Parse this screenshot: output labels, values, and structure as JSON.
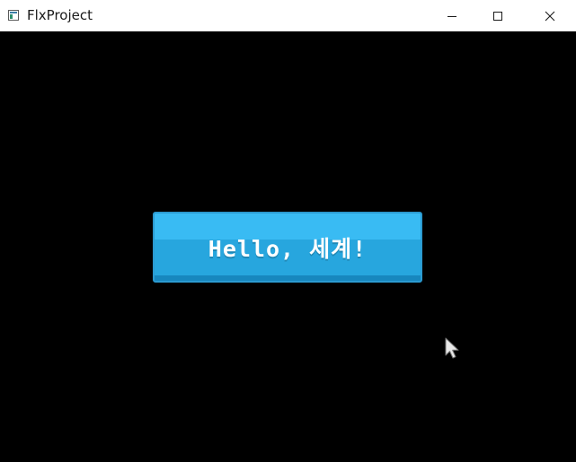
{
  "window": {
    "title": "FlxProject",
    "icon": "app-window-icon",
    "controls": {
      "minimize_icon": "minimize-icon",
      "maximize_icon": "maximize-icon",
      "close_icon": "close-icon"
    }
  },
  "game": {
    "background_color": "#000000",
    "button": {
      "label": "Hello, 세계!",
      "color": "#27a6de",
      "highlight_color": "#39bbf3",
      "shadow_color": "#1787be"
    },
    "cursor_icon": "mouse-pointer-icon"
  }
}
